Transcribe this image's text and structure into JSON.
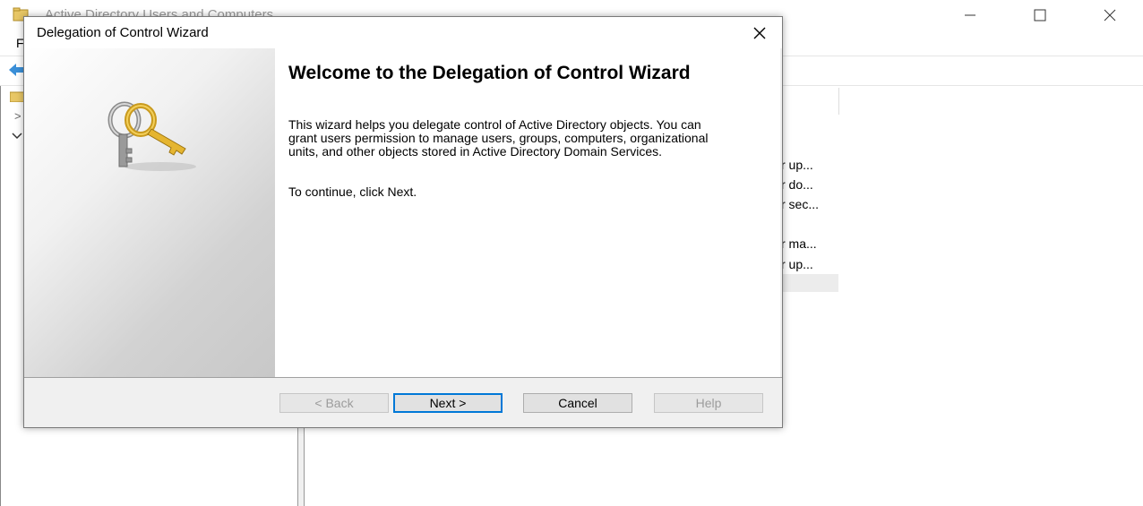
{
  "background_window": {
    "title": "Active Directory Users and Computers",
    "menu_file": "F",
    "caption_buttons": {
      "minimize": "—",
      "maximize": "☐",
      "close": "✕"
    },
    "list_descriptions": [
      "r up...",
      "r do...",
      "r sec...",
      "r ma...",
      "r up..."
    ]
  },
  "wizard": {
    "title": "Delegation of Control Wizard",
    "close_glyph": "✕",
    "heading": "Welcome to the Delegation of Control Wizard",
    "body": "This wizard helps you delegate control of Active Directory objects. You can grant users permission to manage users, groups, computers, organizational units, and other objects stored in Active Directory Domain Services.",
    "continue_text": "To continue, click Next.",
    "buttons": {
      "back": "< Back",
      "next": "Next >",
      "cancel": "Cancel",
      "help": "Help"
    },
    "banner_icon": "keys-icon"
  },
  "colors": {
    "accent_focus": "#0078d7",
    "dialog_background": "#f0f0f0",
    "disabled_text": "#9c9c9c"
  }
}
